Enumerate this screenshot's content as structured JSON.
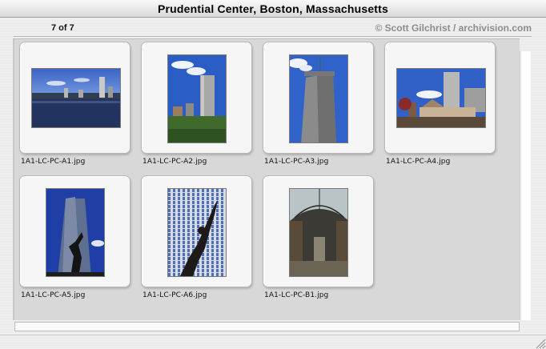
{
  "window": {
    "title": "Prudential Center, Boston, Massachusetts"
  },
  "info": {
    "count": "7 of 7",
    "credit": "© Scott Gilchrist / archivision.com"
  },
  "thumbnails": [
    {
      "filename": "1A1-LC-PC-A1.jpg"
    },
    {
      "filename": "1A1-LC-PC-A2.jpg"
    },
    {
      "filename": "1A1-LC-PC-A3.jpg"
    },
    {
      "filename": "1A1-LC-PC-A4.jpg"
    },
    {
      "filename": "1A1-LC-PC-A5.jpg"
    },
    {
      "filename": "1A1-LC-PC-A6.jpg"
    },
    {
      "filename": "1A1-LC-PC-B1.jpg"
    }
  ],
  "colors": {
    "sky": "#2d57b8",
    "tower": "#8f8f8f",
    "water": "#23335f"
  }
}
